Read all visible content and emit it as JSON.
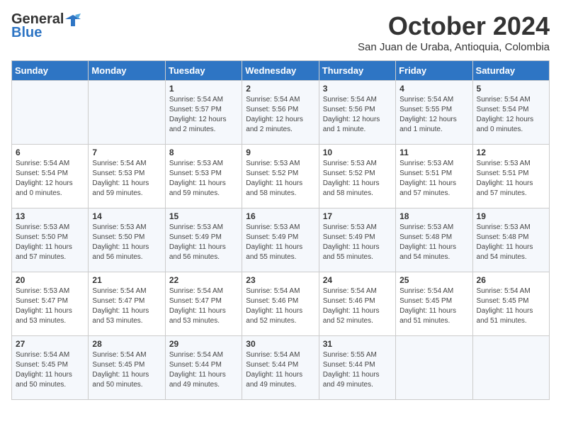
{
  "header": {
    "logo_general": "General",
    "logo_blue": "Blue",
    "month": "October 2024",
    "location": "San Juan de Uraba, Antioquia, Colombia"
  },
  "days_of_week": [
    "Sunday",
    "Monday",
    "Tuesday",
    "Wednesday",
    "Thursday",
    "Friday",
    "Saturday"
  ],
  "weeks": [
    [
      {
        "day": "",
        "sunrise": "",
        "sunset": "",
        "daylight": ""
      },
      {
        "day": "",
        "sunrise": "",
        "sunset": "",
        "daylight": ""
      },
      {
        "day": "1",
        "sunrise": "Sunrise: 5:54 AM",
        "sunset": "Sunset: 5:57 PM",
        "daylight": "Daylight: 12 hours and 2 minutes."
      },
      {
        "day": "2",
        "sunrise": "Sunrise: 5:54 AM",
        "sunset": "Sunset: 5:56 PM",
        "daylight": "Daylight: 12 hours and 2 minutes."
      },
      {
        "day": "3",
        "sunrise": "Sunrise: 5:54 AM",
        "sunset": "Sunset: 5:56 PM",
        "daylight": "Daylight: 12 hours and 1 minute."
      },
      {
        "day": "4",
        "sunrise": "Sunrise: 5:54 AM",
        "sunset": "Sunset: 5:55 PM",
        "daylight": "Daylight: 12 hours and 1 minute."
      },
      {
        "day": "5",
        "sunrise": "Sunrise: 5:54 AM",
        "sunset": "Sunset: 5:54 PM",
        "daylight": "Daylight: 12 hours and 0 minutes."
      }
    ],
    [
      {
        "day": "6",
        "sunrise": "Sunrise: 5:54 AM",
        "sunset": "Sunset: 5:54 PM",
        "daylight": "Daylight: 12 hours and 0 minutes."
      },
      {
        "day": "7",
        "sunrise": "Sunrise: 5:54 AM",
        "sunset": "Sunset: 5:53 PM",
        "daylight": "Daylight: 11 hours and 59 minutes."
      },
      {
        "day": "8",
        "sunrise": "Sunrise: 5:53 AM",
        "sunset": "Sunset: 5:53 PM",
        "daylight": "Daylight: 11 hours and 59 minutes."
      },
      {
        "day": "9",
        "sunrise": "Sunrise: 5:53 AM",
        "sunset": "Sunset: 5:52 PM",
        "daylight": "Daylight: 11 hours and 58 minutes."
      },
      {
        "day": "10",
        "sunrise": "Sunrise: 5:53 AM",
        "sunset": "Sunset: 5:52 PM",
        "daylight": "Daylight: 11 hours and 58 minutes."
      },
      {
        "day": "11",
        "sunrise": "Sunrise: 5:53 AM",
        "sunset": "Sunset: 5:51 PM",
        "daylight": "Daylight: 11 hours and 57 minutes."
      },
      {
        "day": "12",
        "sunrise": "Sunrise: 5:53 AM",
        "sunset": "Sunset: 5:51 PM",
        "daylight": "Daylight: 11 hours and 57 minutes."
      }
    ],
    [
      {
        "day": "13",
        "sunrise": "Sunrise: 5:53 AM",
        "sunset": "Sunset: 5:50 PM",
        "daylight": "Daylight: 11 hours and 57 minutes."
      },
      {
        "day": "14",
        "sunrise": "Sunrise: 5:53 AM",
        "sunset": "Sunset: 5:50 PM",
        "daylight": "Daylight: 11 hours and 56 minutes."
      },
      {
        "day": "15",
        "sunrise": "Sunrise: 5:53 AM",
        "sunset": "Sunset: 5:49 PM",
        "daylight": "Daylight: 11 hours and 56 minutes."
      },
      {
        "day": "16",
        "sunrise": "Sunrise: 5:53 AM",
        "sunset": "Sunset: 5:49 PM",
        "daylight": "Daylight: 11 hours and 55 minutes."
      },
      {
        "day": "17",
        "sunrise": "Sunrise: 5:53 AM",
        "sunset": "Sunset: 5:49 PM",
        "daylight": "Daylight: 11 hours and 55 minutes."
      },
      {
        "day": "18",
        "sunrise": "Sunrise: 5:53 AM",
        "sunset": "Sunset: 5:48 PM",
        "daylight": "Daylight: 11 hours and 54 minutes."
      },
      {
        "day": "19",
        "sunrise": "Sunrise: 5:53 AM",
        "sunset": "Sunset: 5:48 PM",
        "daylight": "Daylight: 11 hours and 54 minutes."
      }
    ],
    [
      {
        "day": "20",
        "sunrise": "Sunrise: 5:53 AM",
        "sunset": "Sunset: 5:47 PM",
        "daylight": "Daylight: 11 hours and 53 minutes."
      },
      {
        "day": "21",
        "sunrise": "Sunrise: 5:54 AM",
        "sunset": "Sunset: 5:47 PM",
        "daylight": "Daylight: 11 hours and 53 minutes."
      },
      {
        "day": "22",
        "sunrise": "Sunrise: 5:54 AM",
        "sunset": "Sunset: 5:47 PM",
        "daylight": "Daylight: 11 hours and 53 minutes."
      },
      {
        "day": "23",
        "sunrise": "Sunrise: 5:54 AM",
        "sunset": "Sunset: 5:46 PM",
        "daylight": "Daylight: 11 hours and 52 minutes."
      },
      {
        "day": "24",
        "sunrise": "Sunrise: 5:54 AM",
        "sunset": "Sunset: 5:46 PM",
        "daylight": "Daylight: 11 hours and 52 minutes."
      },
      {
        "day": "25",
        "sunrise": "Sunrise: 5:54 AM",
        "sunset": "Sunset: 5:45 PM",
        "daylight": "Daylight: 11 hours and 51 minutes."
      },
      {
        "day": "26",
        "sunrise": "Sunrise: 5:54 AM",
        "sunset": "Sunset: 5:45 PM",
        "daylight": "Daylight: 11 hours and 51 minutes."
      }
    ],
    [
      {
        "day": "27",
        "sunrise": "Sunrise: 5:54 AM",
        "sunset": "Sunset: 5:45 PM",
        "daylight": "Daylight: 11 hours and 50 minutes."
      },
      {
        "day": "28",
        "sunrise": "Sunrise: 5:54 AM",
        "sunset": "Sunset: 5:45 PM",
        "daylight": "Daylight: 11 hours and 50 minutes."
      },
      {
        "day": "29",
        "sunrise": "Sunrise: 5:54 AM",
        "sunset": "Sunset: 5:44 PM",
        "daylight": "Daylight: 11 hours and 49 minutes."
      },
      {
        "day": "30",
        "sunrise": "Sunrise: 5:54 AM",
        "sunset": "Sunset: 5:44 PM",
        "daylight": "Daylight: 11 hours and 49 minutes."
      },
      {
        "day": "31",
        "sunrise": "Sunrise: 5:55 AM",
        "sunset": "Sunset: 5:44 PM",
        "daylight": "Daylight: 11 hours and 49 minutes."
      },
      {
        "day": "",
        "sunrise": "",
        "sunset": "",
        "daylight": ""
      },
      {
        "day": "",
        "sunrise": "",
        "sunset": "",
        "daylight": ""
      }
    ]
  ]
}
